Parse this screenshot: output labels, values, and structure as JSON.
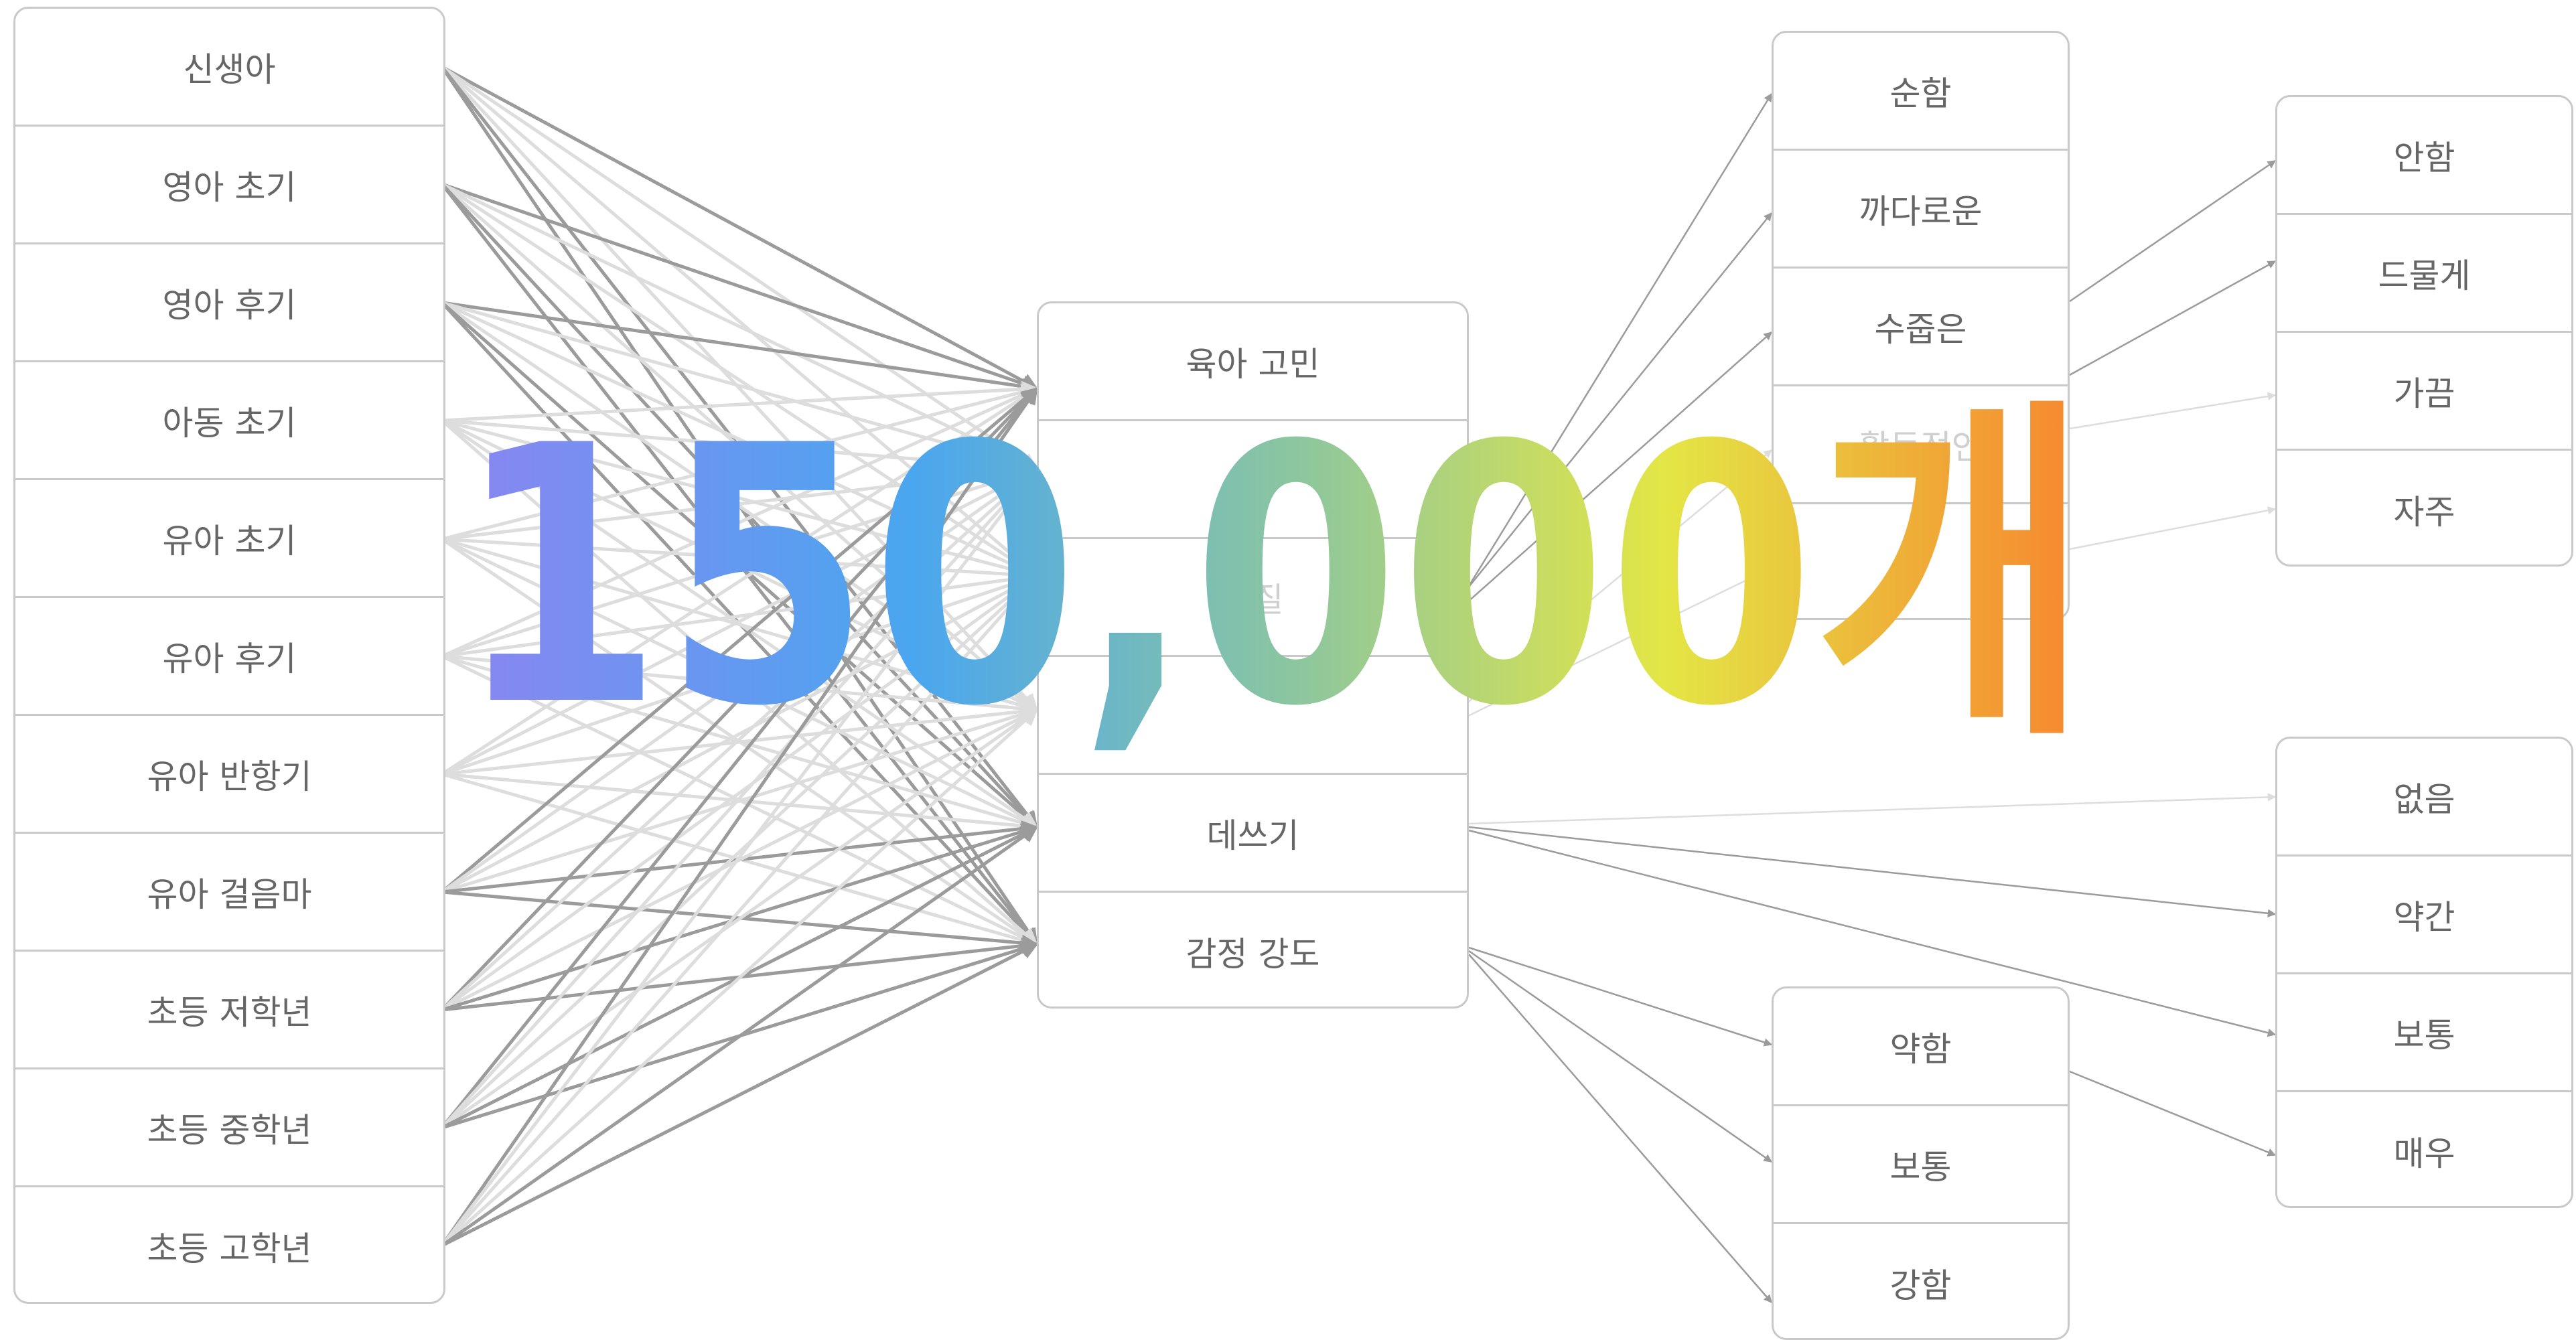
{
  "headline": "150,000개",
  "colors": {
    "gradient": [
      "#8a85f1",
      "#4aa6ef",
      "#8ec79d",
      "#e3e645",
      "#f7852e"
    ],
    "line_dark": "#9b9b9b",
    "line_light": "#dddddd"
  },
  "columns": {
    "ages": [
      "신생아",
      "영아 초기",
      "영아 후기",
      "아동 초기",
      "유아 초기",
      "유아 후기",
      "유아 반항기",
      "유아 걸음마",
      "초등 저학년",
      "초등 중학년",
      "초등 고학년"
    ],
    "concerns": [
      "육아 고민",
      "",
      "기질",
      "",
      "데쓰기",
      "감정 강도"
    ],
    "temperament": [
      "순함",
      "까다로운",
      "수줍은",
      "활동적인",
      ""
    ],
    "frequency": [
      "안함",
      "드물게",
      "가끔",
      "자주"
    ],
    "degree": [
      "없음",
      "약간",
      "보통",
      "매우"
    ],
    "intensity": [
      "약함",
      "보통",
      "강함"
    ]
  }
}
